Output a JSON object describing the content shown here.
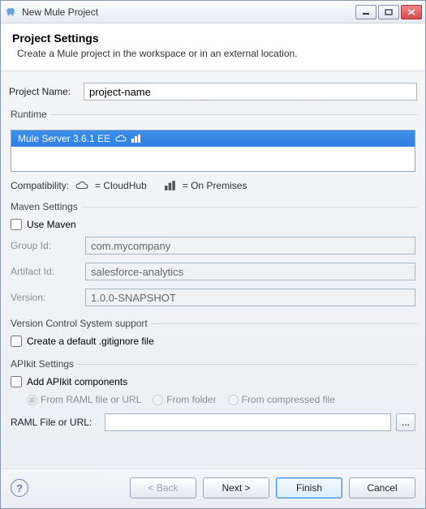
{
  "window": {
    "title": "New Mule Project"
  },
  "header": {
    "title": "Project Settings",
    "subtitle": "Create a Mule project in the workspace or in an external location."
  },
  "project": {
    "name_label": "Project Name:",
    "name_value": "project-name"
  },
  "runtime": {
    "legend": "Runtime",
    "selected": "Mule Server 3.6.1 EE",
    "compat_label": "Compatibility:",
    "cloudhub_label": "= CloudHub",
    "onprem_label": "= On Premises"
  },
  "maven": {
    "legend": "Maven Settings",
    "use_maven_label": "Use Maven",
    "group_id_label": "Group Id:",
    "group_id_value": "com.mycompany",
    "artifact_id_label": "Artifact Id:",
    "artifact_id_value": "salesforce-analytics",
    "version_label": "Version:",
    "version_value": "1.0.0-SNAPSHOT"
  },
  "vcs": {
    "legend": "Version Control System support",
    "gitignore_label": "Create a default .gitignore file"
  },
  "apikit": {
    "legend": "APIkit Settings",
    "add_label": "Add APIkit components",
    "radio_raml": "From RAML file or URL",
    "radio_folder": "From folder",
    "radio_zip": "From compressed file",
    "raml_label": "RAML File or URL:",
    "raml_value": "",
    "browse_label": "..."
  },
  "footer": {
    "back": "< Back",
    "next": "Next >",
    "finish": "Finish",
    "cancel": "Cancel"
  }
}
